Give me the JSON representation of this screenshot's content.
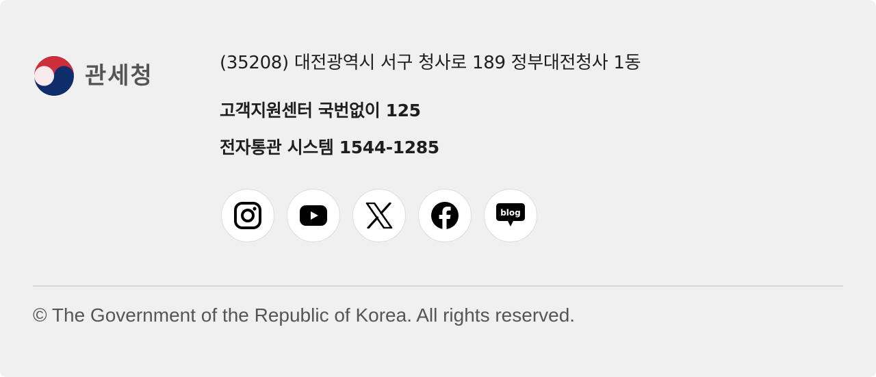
{
  "logo": {
    "text": "관세청"
  },
  "info": {
    "address": "(35208) 대전광역시 서구 청사로 189 정부대전청사 1동",
    "customer_center": "고객지원센터 국번없이 125",
    "electronic_customs": "전자통관 시스템 1544-1285"
  },
  "social": {
    "items": [
      {
        "name": "Instagram",
        "icon": "instagram-icon"
      },
      {
        "name": "YouTube",
        "icon": "youtube-icon"
      },
      {
        "name": "X",
        "icon": "x-icon"
      },
      {
        "name": "Facebook",
        "icon": "facebook-icon"
      },
      {
        "name": "Blog",
        "icon": "blog-icon",
        "icon_text": "blog"
      }
    ]
  },
  "copyright": "© The Government of the Republic of Korea. All rights reserved.",
  "colors": {
    "background": "#f0f0f0",
    "emblem_red": "#cd2e3a",
    "emblem_blue": "#0f2c6b",
    "icon": "#000000"
  }
}
